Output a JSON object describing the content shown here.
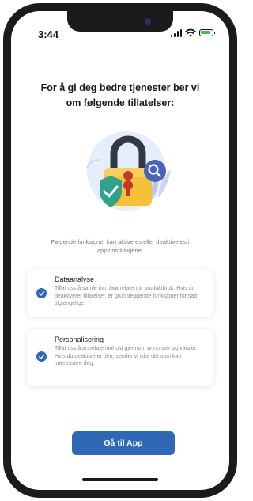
{
  "status_bar": {
    "time": "3:44",
    "icons": [
      "signal-icon",
      "wifi-icon",
      "battery-icon"
    ],
    "battery_color": "#34c759"
  },
  "title": "For å gi deg bedre tjenester ber vi om følgende tillatelser:",
  "illustration": {
    "icons": [
      "padlock-icon",
      "shield-check-icon",
      "magnifier-icon"
    ],
    "colors": {
      "lock": "#f5c13b",
      "shield": "#2fa38a",
      "magnifier": "#4a63b8",
      "backdrop": "#e7eefb"
    }
  },
  "subtitle": "Følgende funksjoner kan aktiveres eller deaktiveres i appinnstillingene.",
  "permissions": [
    {
      "title": "Dataanalyse",
      "description": "Tillat oss å samle inn data relatert til produktbruk. Hvis du deaktiverer tillatelser, er grunnleggende funksjoner fortsatt tilgjengelige.",
      "checked": true
    },
    {
      "title": "Personalisering",
      "description": "Tillat oss å anbefale innhold gjennom annonser og varsler. Hvis du deaktiverer den, sender vi ikke det som kan interessere deg.",
      "checked": true
    }
  ],
  "cta_label": "Gå til App",
  "accent_color": "#2f68b5"
}
